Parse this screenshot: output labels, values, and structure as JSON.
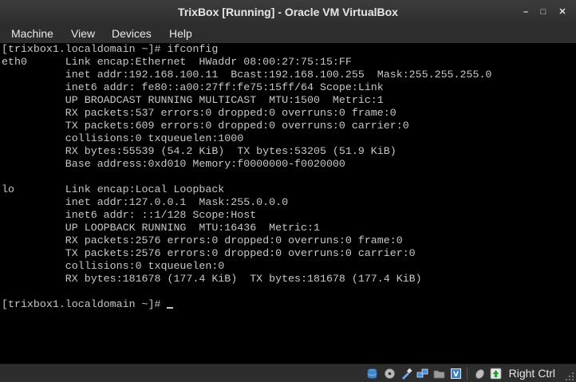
{
  "window": {
    "title": "TrixBox [Running] - Oracle VM VirtualBox",
    "controls": {
      "minimize": "–",
      "maximize": "□",
      "close": "✕"
    }
  },
  "menubar": {
    "items": [
      "Machine",
      "View",
      "Devices",
      "Help"
    ]
  },
  "terminal": {
    "lines": [
      "[trixbox1.localdomain ~]# ifconfig",
      "eth0      Link encap:Ethernet  HWaddr 08:00:27:75:15:FF",
      "          inet addr:192.168.100.11  Bcast:192.168.100.255  Mask:255.255.255.0",
      "          inet6 addr: fe80::a00:27ff:fe75:15ff/64 Scope:Link",
      "          UP BROADCAST RUNNING MULTICAST  MTU:1500  Metric:1",
      "          RX packets:537 errors:0 dropped:0 overruns:0 frame:0",
      "          TX packets:609 errors:0 dropped:0 overruns:0 carrier:0",
      "          collisions:0 txqueuelen:1000",
      "          RX bytes:55539 (54.2 KiB)  TX bytes:53205 (51.9 KiB)",
      "          Base address:0xd010 Memory:f0000000-f0020000",
      "",
      "lo        Link encap:Local Loopback",
      "          inet addr:127.0.0.1  Mask:255.0.0.0",
      "          inet6 addr: ::1/128 Scope:Host",
      "          UP LOOPBACK RUNNING  MTU:16436  Metric:1",
      "          RX packets:2576 errors:0 dropped:0 overruns:0 frame:0",
      "          TX packets:2576 errors:0 dropped:0 overruns:0 carrier:0",
      "          collisions:0 txqueuelen:0",
      "          RX bytes:181678 (177.4 KiB)  TX bytes:181678 (177.4 KiB)",
      "",
      "[trixbox1.localdomain ~]# "
    ]
  },
  "statusbar": {
    "icons": [
      "hard-disk-icon",
      "optical-drive-icon",
      "usb-icon",
      "network-icon",
      "shared-folders-icon",
      "virtualization-icon",
      "mouse-integration-icon",
      "host-key-indicator-icon"
    ],
    "host_key_label": "Right Ctrl"
  }
}
